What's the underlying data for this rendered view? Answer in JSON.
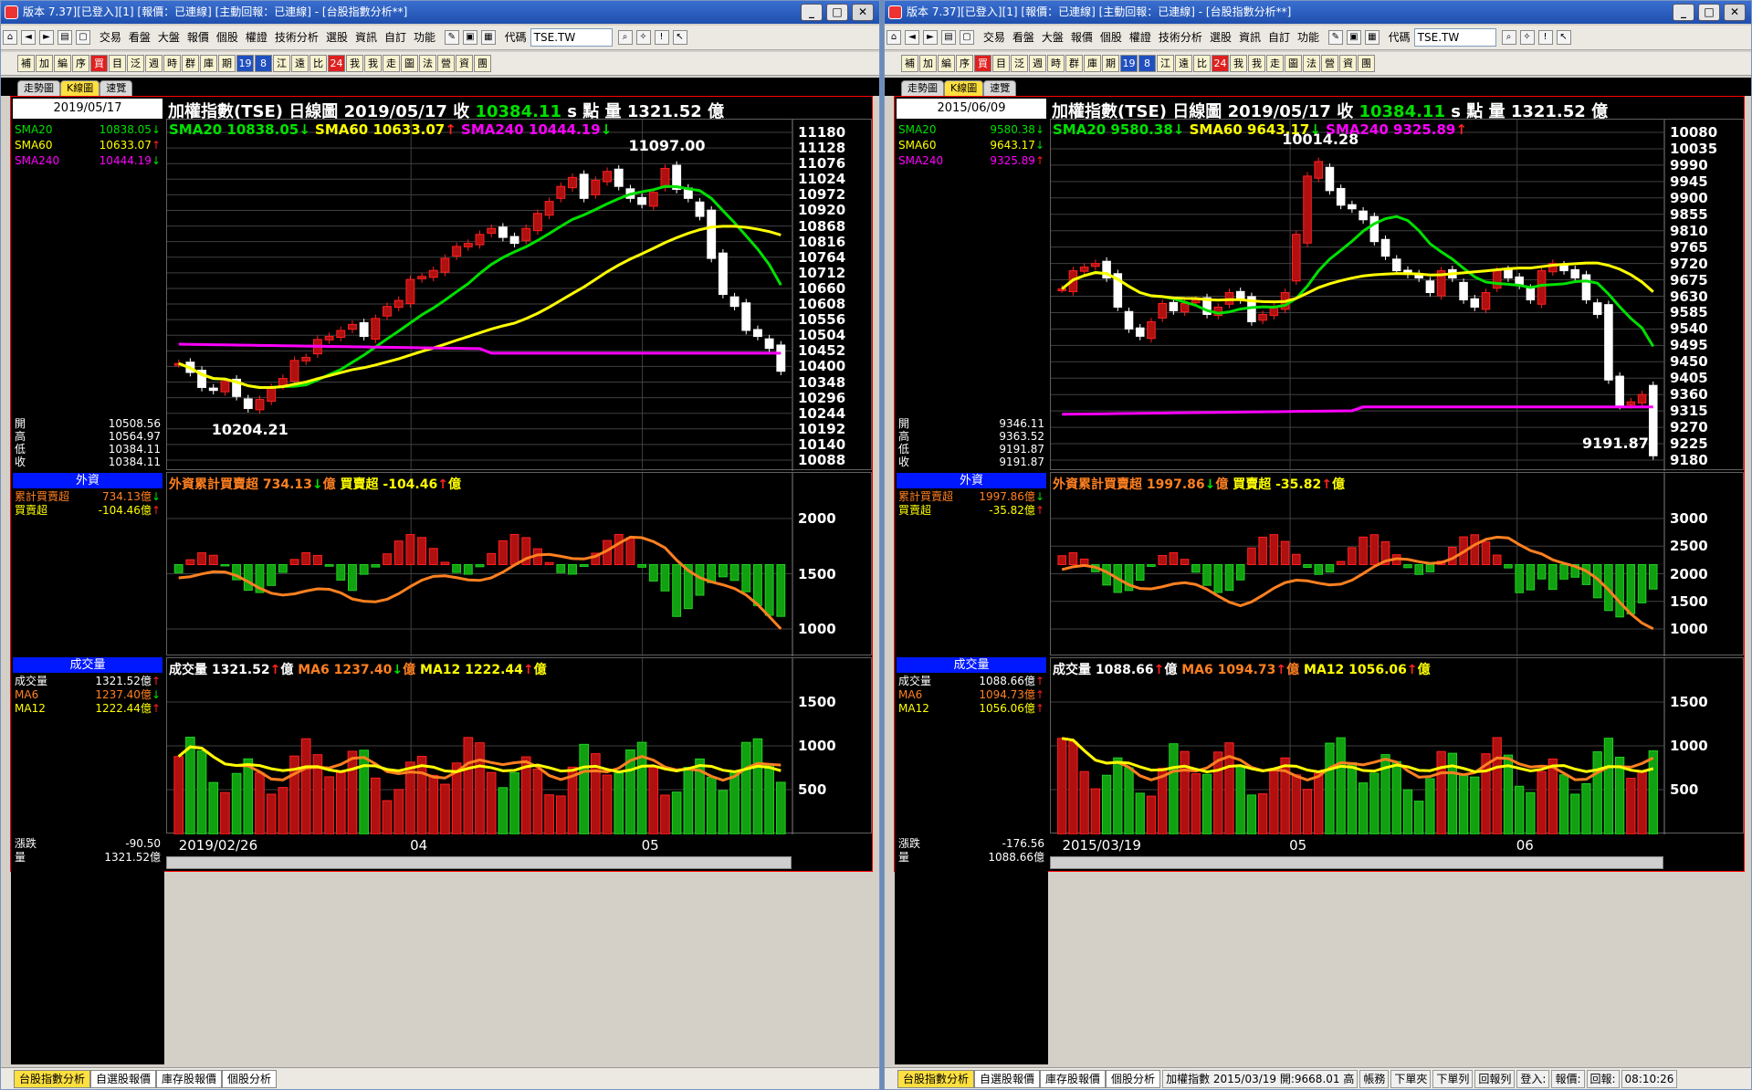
{
  "left": {
    "title": "版本 7.37][已登入][1] [報價：已連線] [主動回報：已連線] - [台股指數分析**]",
    "menu": [
      "交易",
      "看盤",
      "大盤",
      "報價",
      "個股",
      "權證",
      "技術分析",
      "選股",
      "資訊",
      "自訂",
      "功能"
    ],
    "code_label": "代碼",
    "code_value": "TSE.TW",
    "quick": [
      "補",
      "加",
      "編",
      "序",
      "買",
      "目",
      "泛",
      "週",
      "時",
      "群",
      "庫",
      "期",
      "19",
      "8",
      "江",
      "遠",
      "比",
      "24",
      "我",
      "我",
      "走",
      "圖",
      "法",
      "營",
      "資",
      "團"
    ],
    "tabs": [
      "走勢圖",
      "K線圖",
      "速覽"
    ],
    "main_title": "加權指數(TSE)",
    "chart_type": "日線圖",
    "date": "2019/05/17",
    "close_label": "收",
    "close_value": "10384.11",
    "close_unit": "s 點",
    "vol_label": "量",
    "vol_value": "1321.52",
    "vol_unit": "億",
    "side_date": "2019/05/17",
    "sma_rows": [
      {
        "name": "SMA20",
        "value": "10838.05",
        "dir": "↓",
        "color": "#00e000"
      },
      {
        "name": "SMA60",
        "value": "10633.07",
        "dir": "↑",
        "color": "#ffff00"
      },
      {
        "name": "SMA240",
        "value": "10444.19",
        "dir": "↓",
        "color": "#ff00ff"
      }
    ],
    "ohlc": [
      {
        "k": "開",
        "v": "10508.56"
      },
      {
        "k": "高",
        "v": "10564.97"
      },
      {
        "k": "低",
        "v": "10384.11"
      },
      {
        "k": "收",
        "v": "10384.11"
      }
    ],
    "sma_legend": [
      {
        "text": "SMA20 10838.05",
        "arrow": "↓",
        "color": "#00e000",
        "arrowColor": "#00e000"
      },
      {
        "text": "SMA60 10633.07",
        "arrow": "↑",
        "color": "#ffff00",
        "arrowColor": "#ff2020"
      },
      {
        "text": "SMA240 10444.19",
        "arrow": "↓",
        "color": "#ff00ff",
        "arrowColor": "#00e000"
      }
    ],
    "price_ticks": [
      "11180",
      "11128",
      "11076",
      "11024",
      "10972",
      "10920",
      "10868",
      "10816",
      "10764",
      "10712",
      "10660",
      "10608",
      "10556",
      "10504",
      "10452",
      "10400",
      "10348",
      "10296",
      "10244",
      "10192",
      "10140",
      "10088"
    ],
    "high_annot": "11097.00",
    "low_annot": "10204.21",
    "foreign_hdr": "外資",
    "foreign_rows": [
      {
        "k": "累計買賣超",
        "v": "734.13億",
        "dir": "↓",
        "color": "#ff8020"
      },
      {
        "k": "買賣超",
        "v": "-104.46億",
        "dir": "↑",
        "color": "#ffff00"
      }
    ],
    "foreign_legend": [
      {
        "text": "外資累計買賣超 734.13",
        "arrow": "↓",
        "unit": "億",
        "color": "#ff8020",
        "arrowColor": "#00e000"
      },
      {
        "text": "買賣超 -104.46",
        "arrow": "↑",
        "unit": "億",
        "color": "#ffff00",
        "arrowColor": "#ff2020"
      }
    ],
    "foreign_ticks": [
      "2000",
      "1500",
      "1000"
    ],
    "vol_hdr": "成交量",
    "vol_rows": [
      {
        "k": "成交量",
        "v": "1321.52億",
        "dir": "↑",
        "color": "#ffffff"
      },
      {
        "k": "MA6",
        "v": "1237.40億",
        "dir": "↓",
        "color": "#ff8020"
      },
      {
        "k": "MA12",
        "v": "1222.44億",
        "dir": "↑",
        "color": "#ffff00"
      }
    ],
    "vol_legend": [
      {
        "text": "成交量 1321.52",
        "arrow": "↑",
        "unit": "億",
        "color": "#ffffff",
        "arrowColor": "#ff2020"
      },
      {
        "text": "MA6 1237.40",
        "arrow": "↓",
        "unit": "億",
        "color": "#ff8020",
        "arrowColor": "#00e000"
      },
      {
        "text": "MA12 1222.44",
        "arrow": "↑",
        "unit": "億",
        "color": "#ffff00",
        "arrowColor": "#ff2020"
      }
    ],
    "vol_ticks": [
      "1500",
      "1000",
      "500"
    ],
    "x_labels": [
      "2019/02/26",
      "04",
      "05"
    ],
    "bottom_rows": [
      {
        "k": "漲跌",
        "v": "-90.50"
      },
      {
        "k": "量",
        "v": "1321.52億"
      }
    ],
    "status_tabs": [
      "台股指數分析",
      "自選股報價",
      "庫存股報價",
      "個股分析"
    ]
  },
  "right": {
    "title": "版本 7.37][已登入][1] [報價：已連線] [主動回報：已連線] - [台股指數分析**]",
    "menu": [
      "交易",
      "看盤",
      "大盤",
      "報價",
      "個股",
      "權證",
      "技術分析",
      "選股",
      "資訊",
      "自訂",
      "功能"
    ],
    "code_label": "代碼",
    "code_value": "TSE.TW",
    "quick": [
      "補",
      "加",
      "編",
      "序",
      "買",
      "目",
      "泛",
      "週",
      "時",
      "群",
      "庫",
      "期",
      "19",
      "8",
      "江",
      "遠",
      "比",
      "24",
      "我",
      "我",
      "走",
      "圖",
      "法",
      "營",
      "資",
      "團"
    ],
    "tabs": [
      "走勢圖",
      "K線圖",
      "速覽"
    ],
    "main_title": "加權指數(TSE)",
    "chart_type": "日線圖",
    "date": "2019/05/17",
    "close_label": "收",
    "close_value": "10384.11",
    "close_unit": "s 點",
    "vol_label": "量",
    "vol_value": "1321.52",
    "vol_unit": "億",
    "side_date": "2015/06/09",
    "sma_rows": [
      {
        "name": "SMA20",
        "value": "9580.38",
        "dir": "↓",
        "color": "#00e000"
      },
      {
        "name": "SMA60",
        "value": "9643.17",
        "dir": "↓",
        "color": "#ffff00"
      },
      {
        "name": "SMA240",
        "value": "9325.89",
        "dir": "↑",
        "color": "#ff00ff"
      }
    ],
    "ohlc": [
      {
        "k": "開",
        "v": "9346.11"
      },
      {
        "k": "高",
        "v": "9363.52"
      },
      {
        "k": "低",
        "v": "9191.87"
      },
      {
        "k": "收",
        "v": "9191.87"
      }
    ],
    "sma_legend": [
      {
        "text": "SMA20 9580.38",
        "arrow": "↓",
        "color": "#00e000",
        "arrowColor": "#00e000"
      },
      {
        "text": "SMA60 9643.17",
        "arrow": "↓",
        "color": "#ffff00",
        "arrowColor": "#00e000"
      },
      {
        "text": "SMA240 9325.89",
        "arrow": "↑",
        "color": "#ff00ff",
        "arrowColor": "#ff2020"
      }
    ],
    "price_ticks": [
      "10080",
      "10035",
      "9990",
      "9945",
      "9900",
      "9855",
      "9810",
      "9765",
      "9720",
      "9675",
      "9630",
      "9585",
      "9540",
      "9495",
      "9450",
      "9405",
      "9360",
      "9315",
      "9270",
      "9225",
      "9180"
    ],
    "high_annot": "10014.28",
    "low_annot": "9191.87",
    "foreign_hdr": "外資",
    "foreign_rows": [
      {
        "k": "累計買賣超",
        "v": "1997.86億",
        "dir": "↓",
        "color": "#ff8020"
      },
      {
        "k": "買賣超",
        "v": "-35.82億",
        "dir": "↑",
        "color": "#ffff00"
      }
    ],
    "foreign_legend": [
      {
        "text": "外資累計買賣超 1997.86",
        "arrow": "↓",
        "unit": "億",
        "color": "#ff8020",
        "arrowColor": "#00e000"
      },
      {
        "text": "買賣超 -35.82",
        "arrow": "↑",
        "unit": "億",
        "color": "#ffff00",
        "arrowColor": "#ff2020"
      }
    ],
    "foreign_ticks": [
      "3000",
      "2500",
      "2000",
      "1500",
      "1000"
    ],
    "vol_hdr": "成交量",
    "vol_rows": [
      {
        "k": "成交量",
        "v": "1088.66億",
        "dir": "↑",
        "color": "#ffffff"
      },
      {
        "k": "MA6",
        "v": "1094.73億",
        "dir": "↑",
        "color": "#ff8020"
      },
      {
        "k": "MA12",
        "v": "1056.06億",
        "dir": "↑",
        "color": "#ffff00"
      }
    ],
    "vol_legend": [
      {
        "text": "成交量 1088.66",
        "arrow": "↑",
        "unit": "億",
        "color": "#ffffff",
        "arrowColor": "#ff2020"
      },
      {
        "text": "MA6 1094.73",
        "arrow": "↑",
        "unit": "億",
        "color": "#ff8020",
        "arrowColor": "#ff2020"
      },
      {
        "text": "MA12 1056.06",
        "arrow": "↑",
        "unit": "億",
        "color": "#ffff00",
        "arrowColor": "#ff2020"
      }
    ],
    "vol_ticks": [
      "1500",
      "1000",
      "500"
    ],
    "x_labels": [
      "2015/03/19",
      "05",
      "06"
    ],
    "bottom_rows": [
      {
        "k": "漲跌",
        "v": "-176.56"
      },
      {
        "k": "量",
        "v": "1088.66億"
      }
    ],
    "status_tabs": [
      "台股指數分析",
      "自選股報價",
      "庫存股報價",
      "個股分析"
    ],
    "status_info": "加權指數 2015/03/19 開:9668.01 高",
    "status_items": [
      "帳務",
      "下單夾",
      "下單列",
      "回報列",
      "登入:",
      "報價:",
      "回報:"
    ],
    "clock": "08:10:26"
  },
  "chart_data": [
    {
      "type": "candlestick",
      "title": "加權指數(TSE) 日線圖",
      "x_range": [
        "2019/02/26",
        "2019/05/17"
      ],
      "ylim": [
        10088,
        11180
      ],
      "candles_close": [
        10410,
        10380,
        10330,
        10320,
        10350,
        10300,
        10260,
        10290,
        10330,
        10360,
        10420,
        10430,
        10490,
        10500,
        10520,
        10540,
        10500,
        10560,
        10600,
        10620,
        10690,
        10700,
        10720,
        10760,
        10800,
        10810,
        10840,
        10860,
        10830,
        10810,
        10860,
        10910,
        10950,
        11000,
        11030,
        10960,
        11020,
        11050,
        11000,
        10960,
        10940,
        10980,
        11060,
        10990,
        10960,
        10900,
        10760,
        10640,
        10600,
        10520,
        10500,
        10460,
        10384
      ],
      "sma20_end": 10838.05,
      "sma60_end": 10633.07,
      "sma240_end": 10444.19,
      "foreign_cum_end": 734.13,
      "foreign_net_end": -104.46,
      "volume_end": 1321.52,
      "ma6_end": 1237.4,
      "ma12_end": 1222.44
    },
    {
      "type": "candlestick",
      "title": "加權指數(TSE) 日線圖",
      "x_range": [
        "2015/03/19",
        "2015/06/09"
      ],
      "ylim": [
        9180,
        10080
      ],
      "candles_close": [
        9650,
        9700,
        9710,
        9720,
        9680,
        9600,
        9540,
        9520,
        9560,
        9610,
        9590,
        9610,
        9620,
        9580,
        9600,
        9640,
        9620,
        9560,
        9580,
        9600,
        9640,
        9800,
        9960,
        10000,
        9920,
        9880,
        9870,
        9840,
        9780,
        9740,
        9700,
        9690,
        9680,
        9640,
        9700,
        9680,
        9620,
        9600,
        9640,
        9700,
        9680,
        9660,
        9620,
        9700,
        9720,
        9700,
        9680,
        9620,
        9580,
        9400,
        9330,
        9340,
        9360,
        9191.87
      ],
      "sma20_end": 9580.38,
      "sma60_end": 9643.17,
      "sma240_end": 9325.89,
      "foreign_cum_end": 1997.86,
      "foreign_net_end": -35.82,
      "volume_end": 1088.66,
      "ma6_end": 1094.73,
      "ma12_end": 1056.06
    }
  ]
}
